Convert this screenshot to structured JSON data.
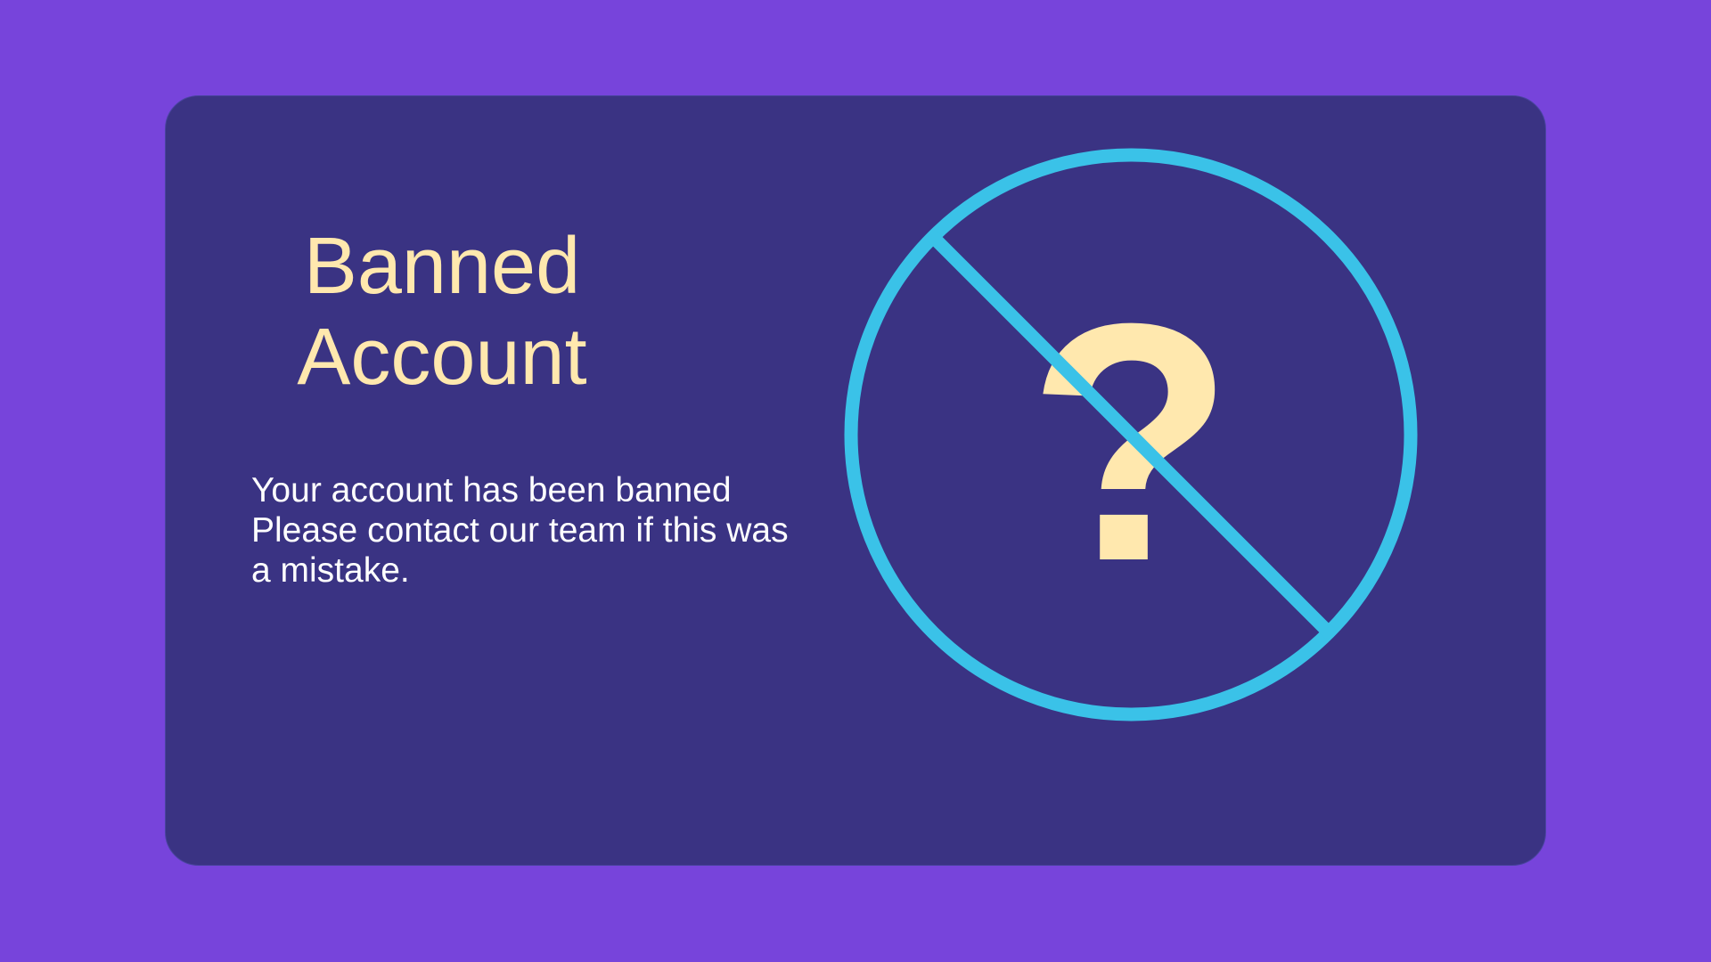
{
  "colors": {
    "background": "#7744DB",
    "card": "#3A3383",
    "title": "#FFE8AE",
    "message": "#FFFFFF",
    "accent": "#3AC2E8",
    "question_mark": "#FFE8AE"
  },
  "banned": {
    "title_line1": "Banned",
    "title_line2": "Account",
    "message_line1": "Your account has been banned",
    "message_line2": "Please contact our team if this was",
    "message_line3": "a mistake.",
    "illustration": {
      "icon": "prohibited-question-icon",
      "glyph": "?"
    }
  }
}
